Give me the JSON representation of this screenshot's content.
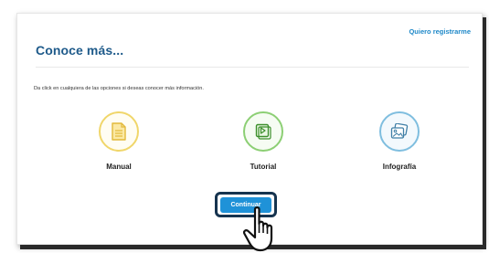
{
  "header": {
    "register_link": "Quiero registrarme"
  },
  "main": {
    "title": "Conoce más...",
    "instructions": "Da click en cualquiera de las opciones si deseas conocer más información.",
    "options": [
      {
        "label": "Manual",
        "icon": "document-icon",
        "color": "#f0d66a"
      },
      {
        "label": "Tutorial",
        "icon": "video-icon",
        "color": "#8ccf74"
      },
      {
        "label": "Infografía",
        "icon": "image-icon",
        "color": "#7fbedf"
      }
    ],
    "continue_label": "Continuar"
  },
  "colors": {
    "accent": "#1f92d8",
    "title": "#1e5a8a",
    "link": "#1e88c8",
    "highlight_border": "#16344f"
  }
}
